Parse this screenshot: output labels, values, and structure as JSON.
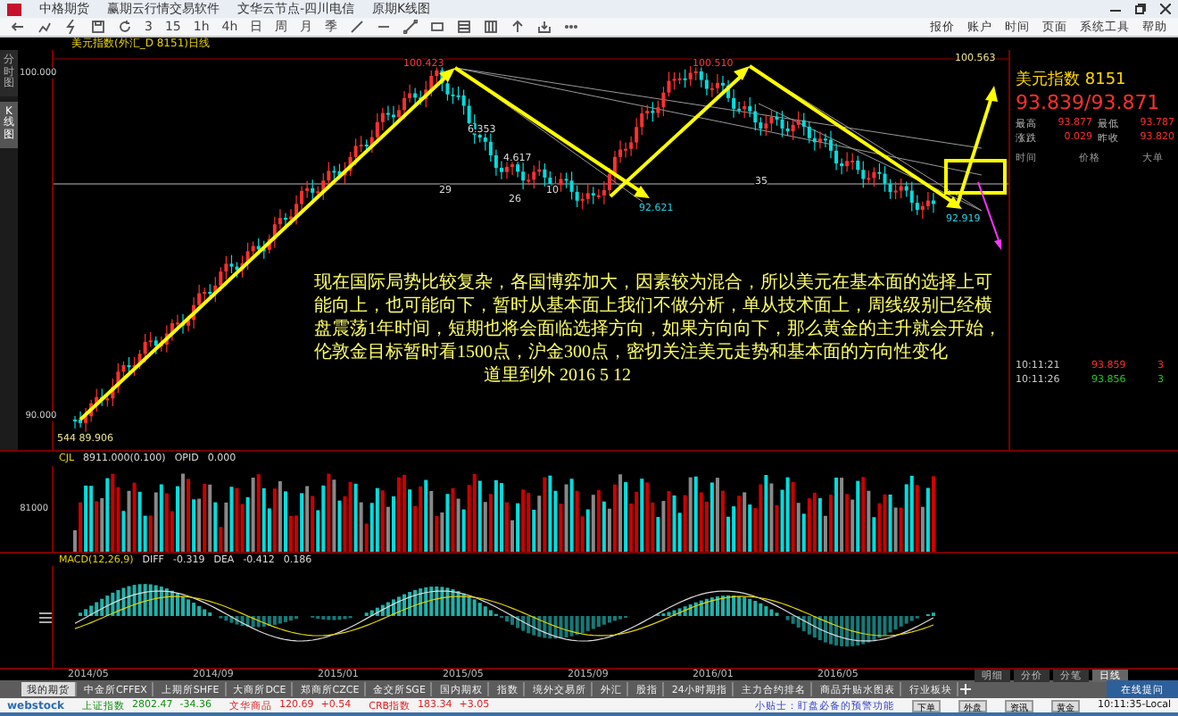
{
  "window": {
    "title_parts": [
      "中格期货",
      "赢期云行情交易软件",
      "文华云节点-四川电信",
      "原期K线图"
    ]
  },
  "menu": [
    "报价",
    "账户",
    "时间",
    "页面",
    "系统工具",
    "帮助"
  ],
  "toolbar_texts": [
    "3",
    "15",
    "1h",
    "4h",
    "日",
    "周",
    "月",
    "季"
  ],
  "side_tabs": [
    {
      "label": "分时图",
      "selected": false
    },
    {
      "label": "K线图",
      "selected": true
    }
  ],
  "chart": {
    "title": "美元指数(外汇_D 8151)日线",
    "axis_labels": [
      "100.000",
      "90.000"
    ],
    "annotations": [
      {
        "text": "100.423",
        "kind": "high"
      },
      {
        "text": "100.510",
        "kind": "high"
      },
      {
        "text": "100.563",
        "kind": "level"
      },
      {
        "text": "6.353",
        "kind": "measure"
      },
      {
        "text": "4.617",
        "kind": "measure"
      },
      {
        "text": "29",
        "kind": "count"
      },
      {
        "text": "26",
        "kind": "count"
      },
      {
        "text": "10",
        "kind": "count"
      },
      {
        "text": "35",
        "kind": "count"
      },
      {
        "text": "92.621",
        "kind": "low"
      },
      {
        "text": "92.919",
        "kind": "low"
      },
      {
        "text": "544 89.906",
        "kind": "level"
      }
    ],
    "commentary": "现在国际局势比较复杂，各国博弈加大，因素较为混合，所以美元在基本面的选择上可能向上，也可能向下，暂时从基本面上我们不做分析，单从技术面上，周线级别已经横盘震荡1年时间，短期也将会面临选择方向，如果方向向下，那么黄金的主升就会开始，伦敦金目标暂时看1500点，沪金300点，密切关注美元走势和基本面的方向性变化",
    "signature": "道里到外 2016 5  12"
  },
  "quote": {
    "name": "美元指数 8151",
    "price": "93.839/93.871",
    "stats": [
      {
        "label": "最高",
        "value": "93.877"
      },
      {
        "label": "最低",
        "value": "93.787"
      },
      {
        "label": "涨跌",
        "value": "0.029"
      },
      {
        "label": "昨收",
        "value": "93.820"
      }
    ],
    "columns": [
      "时间",
      "价格",
      "大单"
    ],
    "ticks": [
      {
        "time": "10:11:21",
        "price": "93.859",
        "size": "3",
        "color": "#ff3030"
      },
      {
        "time": "10:11:26",
        "price": "93.856",
        "size": "3",
        "color": "#22cc22"
      }
    ]
  },
  "volume": {
    "header": [
      "CJL",
      "8911.000(0.100)",
      "OPID",
      "0.000"
    ],
    "axis_label": "81000"
  },
  "macd": {
    "header": [
      "MACD(12,26,9)",
      "DIFF",
      "-0.319",
      "DEA",
      "-0.412",
      "0.186"
    ]
  },
  "dates": [
    "2014/05",
    "2014/09",
    "2015/01",
    "2015/05",
    "2015/09",
    "2016/01",
    "2016/05"
  ],
  "periods": [
    {
      "label": "明细",
      "selected": false
    },
    {
      "label": "分价",
      "selected": false
    },
    {
      "label": "分笔",
      "selected": false
    },
    {
      "label": "日线",
      "selected": true
    }
  ],
  "market_tabs": [
    {
      "label": "我的期货",
      "selected": true
    },
    {
      "label": "中金所CFFEX",
      "selected": false
    },
    {
      "label": "上期所SHFE",
      "selected": false
    },
    {
      "label": "大商所DCE",
      "selected": false
    },
    {
      "label": "郑商所CZCE",
      "selected": false
    },
    {
      "label": "金交所SGE",
      "selected": false
    },
    {
      "label": "国内期权",
      "selected": false
    },
    {
      "label": "指数",
      "selected": false
    },
    {
      "label": "境外交易所",
      "selected": false
    },
    {
      "label": "外汇",
      "selected": false
    },
    {
      "label": "股指",
      "selected": false
    },
    {
      "label": "24小时期指",
      "selected": false
    },
    {
      "label": "主力合约排名",
      "selected": false
    },
    {
      "label": "商品升贴水图表",
      "selected": false
    },
    {
      "label": "行业板块",
      "selected": false
    }
  ],
  "forum_button": "在线提问",
  "status": {
    "logo": "webstock",
    "tickers": [
      {
        "name": "上证指数",
        "value": "2802.47",
        "change": "-34.36",
        "color": "#109010"
      },
      {
        "name": "文华商品",
        "value": "120.69",
        "change": "+0.54",
        "color": "#e02020"
      },
      {
        "name": "CRB指数",
        "value": "183.34",
        "change": "+3.05",
        "color": "#e02020"
      }
    ],
    "tip": "小贴士：盯盘必备的预警功能",
    "buttons": [
      "下单",
      "外盘",
      "资讯",
      "黄金"
    ],
    "time": "10:11:35-Local"
  }
}
